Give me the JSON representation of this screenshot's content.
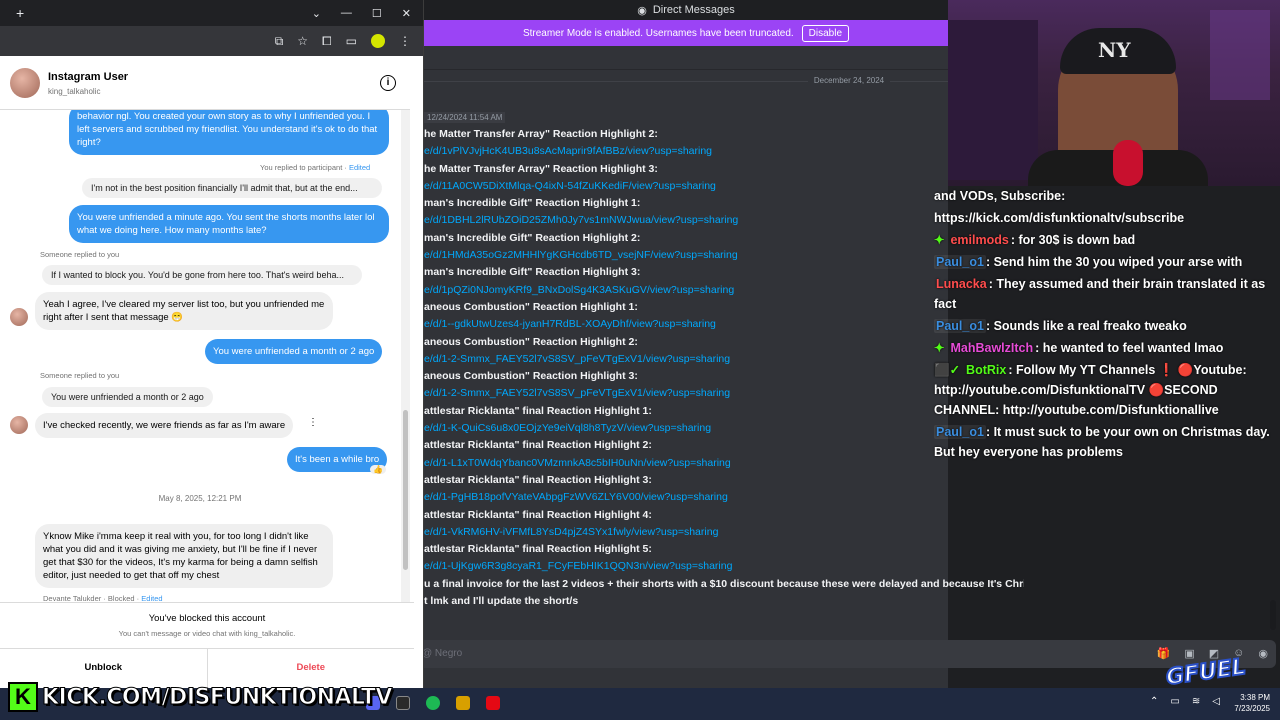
{
  "discord": {
    "window_title": "Direct Messages",
    "streamer_notice": "Streamer Mode is enabled. Usernames have been truncated.",
    "disable_label": "Disable",
    "date_separator": "December 24, 2024",
    "timestamp": "12/24/2024 11:54 AM",
    "message_lines": [
      {
        "t": "b",
        "text": "he Matter Transfer Array\" Reaction Highlight 2:"
      },
      {
        "t": "l",
        "text": "e/d/1vPlVJvjHcK4UB3u8sAcMaprir9fAfBBz/view?usp=sharing"
      },
      {
        "t": "b",
        "text": "he Matter Transfer Array\" Reaction Highlight 3:"
      },
      {
        "t": "l",
        "text": "e/d/11A0CW5DiXtMlqa-Q4ixN-54fZuKKediF/view?usp=sharing"
      },
      {
        "t": "b",
        "text": "man's Incredible Gift\" Reaction Highlight 1:"
      },
      {
        "t": "l",
        "text": "e/d/1DBHL2lRUbZOiD25ZMh0Jy7vs1mNWJwua/view?usp=sharing"
      },
      {
        "t": "b",
        "text": "man's Incredible Gift\" Reaction Highlight 2:"
      },
      {
        "t": "l",
        "text": "e/d/1HMdA35oGz2MHHlYgKGHcdb6TD_vsejNF/view?usp=sharing"
      },
      {
        "t": "b",
        "text": "man's Incredible Gift\" Reaction Highlight 3:"
      },
      {
        "t": "l",
        "text": "e/d/1pQZi0NJomyKRf9_BNxDolSg4K3ASKuGV/view?usp=sharing"
      },
      {
        "t": "b",
        "text": "aneous Combustion\" Reaction Highlight 1:"
      },
      {
        "t": "l",
        "text": "e/d/1--gdkUtwUzes4-jyanH7RdBL-XOAyDhf/view?usp=sharing"
      },
      {
        "t": "b",
        "text": "aneous Combustion\" Reaction Highlight 2:"
      },
      {
        "t": "l",
        "text": "e/d/1-2-Smmx_FAEY52l7vS8SV_pFeVTgExV1/view?usp=sharing"
      },
      {
        "t": "b",
        "text": "aneous Combustion\" Reaction Highlight 3:"
      },
      {
        "t": "l",
        "text": "e/d/1-2-Smmx_FAEY52l7vS8SV_pFeVTgExV1/view?usp=sharing"
      },
      {
        "t": "b",
        "text": "attlestar Ricklanta\" final Reaction Highlight 1:"
      },
      {
        "t": "l",
        "text": "e/d/1-K-QuiCs6u8x0EOjzYe9eiVql8h8TyzV/view?usp=sharing"
      },
      {
        "t": "b",
        "text": "attlestar Ricklanta\" final Reaction Highlight 2:"
      },
      {
        "t": "l",
        "text": "e/d/1-L1xT0WdqYbanc0VMzmnkA8c5bIH0uNn/view?usp=sharing"
      },
      {
        "t": "b",
        "text": "attlestar Ricklanta\" final Reaction Highlight 3:"
      },
      {
        "t": "l",
        "text": "e/d/1-PgHB18pofVYateVAbpgFzWV6ZLY6V00/view?usp=sharing"
      },
      {
        "t": "b",
        "text": "attlestar Ricklanta\" final Reaction Highlight 4:"
      },
      {
        "t": "l",
        "text": "e/d/1-VkRM6HV-iVFMfL8YsD4pjZ4SYx1fwly/view?usp=sharing"
      },
      {
        "t": "b",
        "text": "attlestar Ricklanta\" final Reaction Highlight 5:"
      },
      {
        "t": "l",
        "text": "e/d/1-UjKgw6R3g8cyaR1_FCyFEbHIK1QQN3n/view?usp=sharing"
      },
      {
        "t": "b",
        "text": "u a final invoice for the last 2 videos + their shorts with a $10 discount because these were delayed and because It's Christmas"
      },
      {
        "t": "b",
        "text": "t lmk and I'll update the short/s"
      }
    ],
    "input_placeholder": "@ Negro"
  },
  "stream_chat": {
    "lines": [
      {
        "parts": [
          {
            "k": "text",
            "v": "and VODs, Subscribe:"
          }
        ]
      },
      {
        "parts": [
          {
            "k": "text",
            "v": "https://kick.com/disfunktionaltv/subscribe"
          }
        ]
      },
      {
        "parts": [
          {
            "k": "gem",
            "v": "✦"
          },
          {
            "k": "user-red",
            "v": "emilmods"
          },
          {
            "k": "text",
            "v": ": for 30$ is down bad"
          }
        ]
      },
      {
        "parts": [
          {
            "k": "user-blue",
            "v": "Paul_o1"
          },
          {
            "k": "text",
            "v": ": Send him the 30 you wiped your arse with"
          }
        ]
      },
      {
        "parts": [
          {
            "k": "user-red",
            "v": "Lunacka"
          },
          {
            "k": "text",
            "v": ": They assumed and their brain translated it as fact"
          }
        ]
      },
      {
        "parts": [
          {
            "k": "user-blue",
            "v": "Paul_o1"
          },
          {
            "k": "text",
            "v": ": Sounds like a real freako tweako"
          }
        ]
      },
      {
        "parts": [
          {
            "k": "gem",
            "v": "✦"
          },
          {
            "k": "user-pink",
            "v": "MahBawlzItch"
          },
          {
            "k": "text",
            "v": ": he wanted to feel wanted lmao"
          }
        ]
      },
      {
        "parts": [
          {
            "k": "gem",
            "v": "⬛✓"
          },
          {
            "k": "user-green",
            "v": "BotRix"
          },
          {
            "k": "text",
            "v": ": Follow My YT Channels ❗ 🔴Youtube: http://youtube.com/DisfunktionalTV 🔴SECOND CHANNEL: http://youtube.com/Disfunktionallive"
          }
        ]
      },
      {
        "parts": [
          {
            "k": "user-blue",
            "v": "Paul_o1"
          },
          {
            "k": "text",
            "v": ": It must suck to be your own on Christmas day. But hey everyone has problems"
          }
        ]
      }
    ]
  },
  "instagram": {
    "display_name": "Instagram User",
    "handle": "king_talkaholic",
    "msg1": "behavior ngl. You created your own story as to why I unfriended you. I left servers and scrubbed my friendlist. You understand it's ok to do that right?",
    "you_replied": "You replied to participant",
    "edited": "Edited",
    "quote1": "I'm not in the best position financially I'll admit that, but at the end...",
    "msg2": "You were unfriended a minute ago. You sent the shorts months later lol what we doing here. How many months late?",
    "someone_replied": "Someone replied to you",
    "quote2": "If I wanted to block you. You'd be gone from here too. That's weird beha...",
    "msg3": "Yeah I agree, I've cleared my server list too, but you unfriended me right after I sent that message 😁",
    "msg4": "You were unfriended a month or 2 ago",
    "quote3": "You were unfriended a month or 2 ago",
    "msg5": "I've checked recently, we were friends as far as I'm aware",
    "msg6": "It's been a while bro",
    "reaction": "👍",
    "date2": "May 8, 2025, 12:21 PM",
    "msg7": "Yknow Mike i'mma keep it real with you, for too long I didn't like what you did and it was giving me anxiety, but I'll be fine if I never get that $30 for the videos, It's my karma for being a damn selfish editor, just needed to get that off my chest",
    "footer_author": "Devante Talukder · Blocked ·",
    "blocked_title": "You've blocked this account",
    "blocked_sub": "You can't message or video chat with king_talkaholic.",
    "unblock": "Unblock",
    "delete": "Delete"
  },
  "overlay": {
    "kick_letter": "K",
    "kick_url": "KICK.COM/DISFUNKTIONALTV",
    "gfuel": "GFUEL"
  },
  "taskbar": {
    "time": "3:38 PM",
    "date": "7/23/2025"
  }
}
